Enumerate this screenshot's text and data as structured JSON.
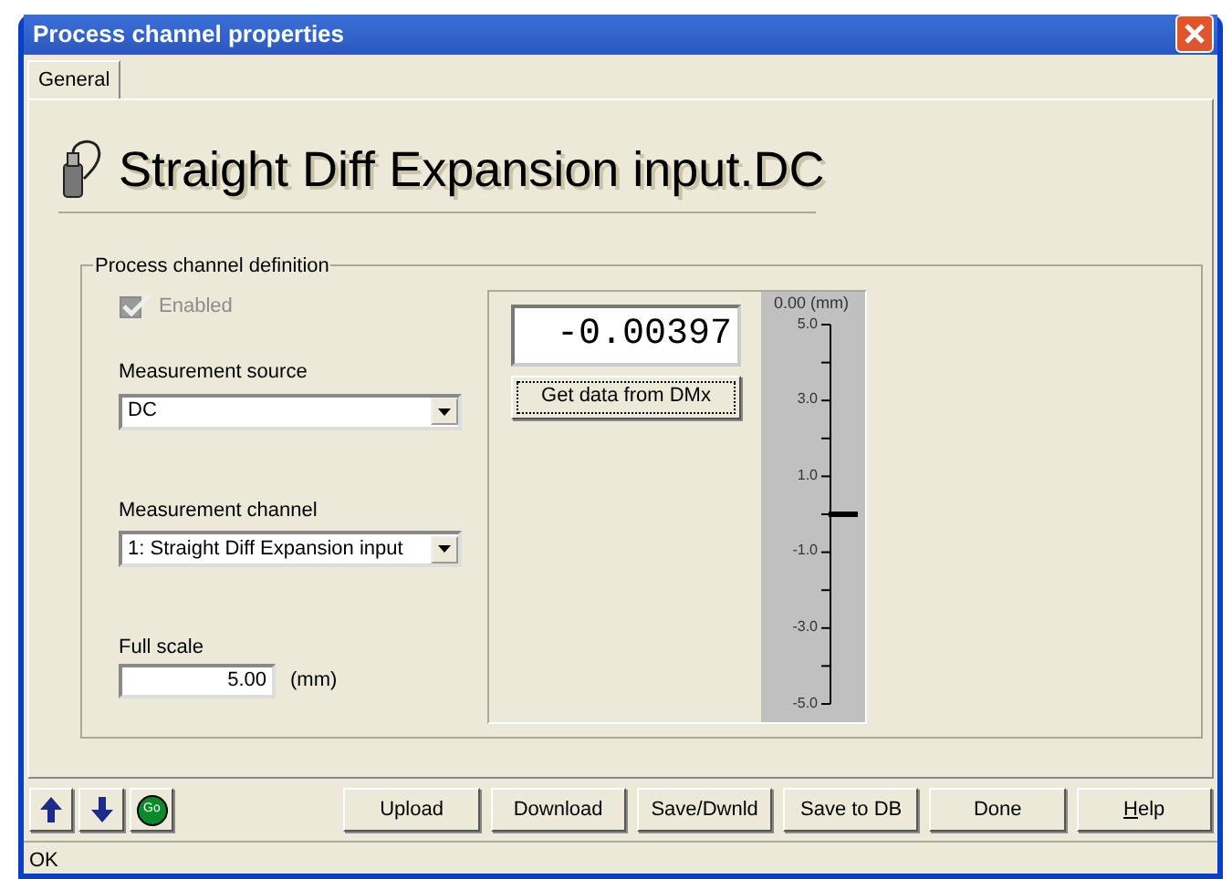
{
  "window": {
    "title": "Process channel properties"
  },
  "tabs": [
    {
      "label": "General",
      "selected": true
    }
  ],
  "heading": "Straight Diff Expansion input.DC",
  "group": {
    "title": "Process channel definition",
    "enabled": {
      "label": "Enabled",
      "checked": true,
      "disabled": true
    },
    "measurement_source": {
      "label": "Measurement source",
      "value": "DC"
    },
    "measurement_channel": {
      "label": "Measurement channel",
      "value": "1: Straight Diff Expansion input"
    },
    "full_scale": {
      "label": "Full scale",
      "value": "5.00",
      "unit": "(mm)"
    }
  },
  "reading": {
    "value": "-0.00397",
    "button": "Get data from DMx"
  },
  "gauge": {
    "header": "0.00 (mm)",
    "ticks": [
      "5.0",
      "3.0",
      "1.0",
      "-1.0",
      "-3.0",
      "-5.0"
    ],
    "level": 0.5
  },
  "nav_buttons": [
    {
      "kind": "up"
    },
    {
      "kind": "down"
    },
    {
      "kind": "go",
      "label": "Go"
    }
  ],
  "buttons": [
    {
      "label": "Upload"
    },
    {
      "label": "Download"
    },
    {
      "label": "Save/Dwnld"
    },
    {
      "label": "Save to DB"
    },
    {
      "label": "Done"
    },
    {
      "label": "Help",
      "accel": true
    }
  ],
  "status_bar": "OK"
}
